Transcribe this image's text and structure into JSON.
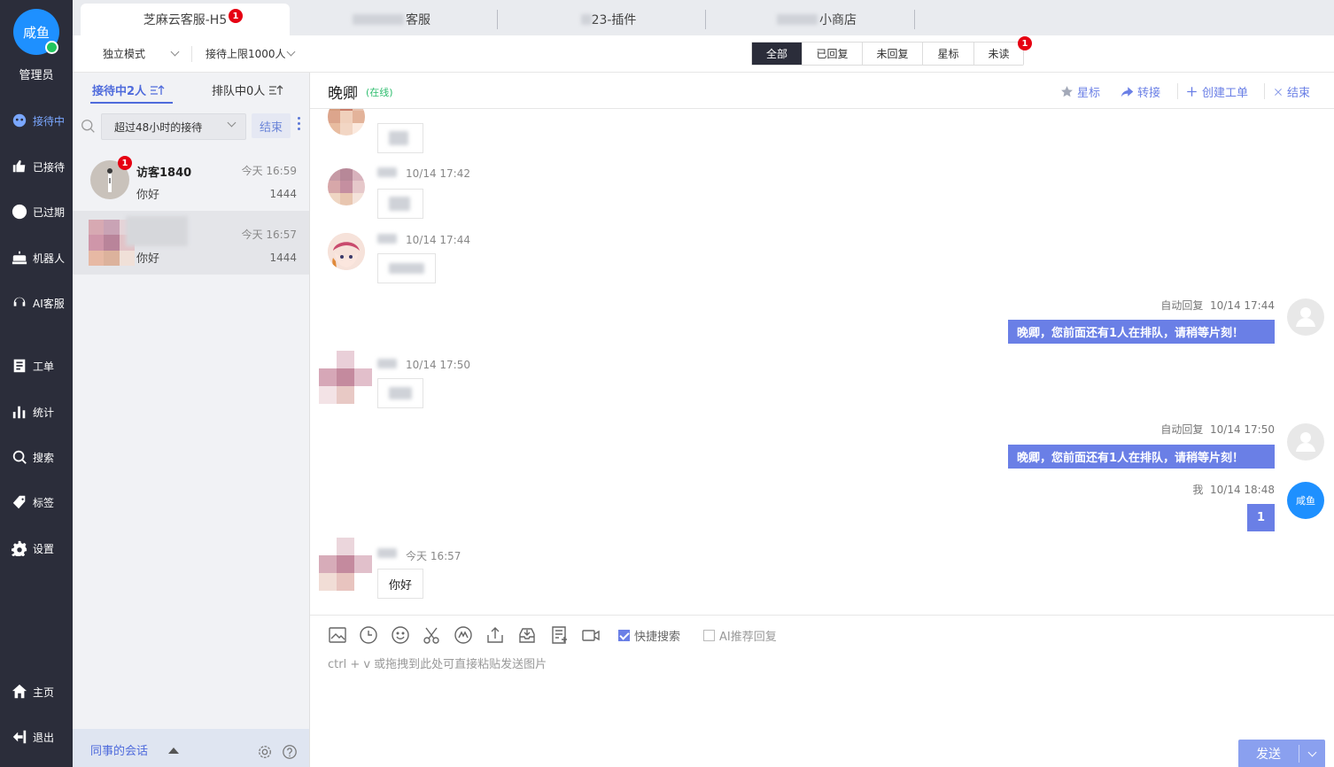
{
  "agent": {
    "avatar_text": "咸鱼",
    "role": "管理员"
  },
  "nav": [
    {
      "label": "接待中",
      "icon": "robot-face-icon",
      "active": true
    },
    {
      "label": "已接待",
      "icon": "inbox-check-icon"
    },
    {
      "label": "已过期",
      "icon": "expired-bolt-icon"
    },
    {
      "label": "机器人",
      "icon": "robot-icon"
    },
    {
      "label": "AI客服",
      "icon": "headset-icon"
    },
    {
      "label": "工单",
      "icon": "ticket-icon"
    },
    {
      "label": "统计",
      "icon": "bar-chart-icon"
    },
    {
      "label": "搜索",
      "icon": "search-icon"
    },
    {
      "label": "标签",
      "icon": "tag-icon"
    },
    {
      "label": "设置",
      "icon": "gear-icon"
    },
    {
      "label": "主页",
      "icon": "home-icon"
    },
    {
      "label": "退出",
      "icon": "logout-icon"
    }
  ],
  "top_tabs": [
    {
      "label": "芝麻云客服-H5",
      "badge": "1",
      "active": true
    },
    {
      "label": "客服"
    },
    {
      "label": "23-插件"
    },
    {
      "label": "小商店"
    }
  ],
  "toolbar": {
    "mode_label": "独立模式",
    "limit_label": "接待上限1000人",
    "filters": [
      "全部",
      "已回复",
      "未回复",
      "星标",
      "未读"
    ],
    "unread_badge": "1"
  },
  "sessions_panel": {
    "tab_active": "接待中2人",
    "tab_queue": "排队中0人",
    "range_select": "超过48小时的接待",
    "end_button": "结束",
    "items": [
      {
        "name": "访客1840",
        "time": "今天 16:59",
        "message": "你好",
        "count": "1444",
        "badge": "1"
      },
      {
        "name": "",
        "time": "今天 16:57",
        "message": "你好",
        "count": "1444"
      }
    ],
    "colleague_label": "同事的会话"
  },
  "chat": {
    "title": "晚卿",
    "status": "(在线)",
    "actions": {
      "star": "星标",
      "transfer": "转接",
      "ticket": "创建工单",
      "end": "结束"
    },
    "messages": [
      {
        "time": "10/14 17:42"
      },
      {
        "time": "10/14 17:44"
      },
      {
        "sender": "自动回复",
        "time": "10/14 17:44",
        "text": "晚卿，您前面还有1人在排队，请稍等片刻！"
      },
      {
        "time": "10/14 17:50"
      },
      {
        "sender": "自动回复",
        "time": "10/14 17:50",
        "text": "晚卿，您前面还有1人在排队，请稍等片刻！"
      },
      {
        "sender": "我",
        "time": "10/14 18:48",
        "text": "1",
        "avatar": "咸鱼"
      },
      {
        "time": "今天 16:57",
        "text": "你好"
      }
    ]
  },
  "composer": {
    "quick_search": "快捷搜索",
    "ai_recommend": "AI推荐回复",
    "hint": "ctrl + v 或拖拽到此处可直接粘贴发送图片",
    "send": "发送"
  },
  "colors": {
    "nav_bg": "#2b2d3a",
    "accent": "#4f6bdc",
    "bubble_out": "#6a7fe6",
    "badge": "#e60012"
  }
}
